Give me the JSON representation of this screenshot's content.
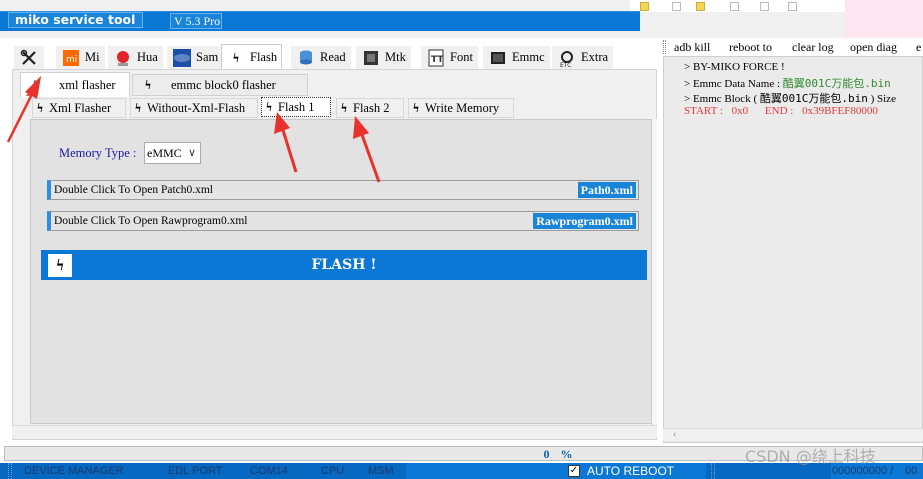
{
  "window": {
    "title": "miko service tool",
    "version": "V 5.3 Pro"
  },
  "menu": {
    "tools_icon": "tools-icon",
    "items": [
      {
        "label": "Mi",
        "icon": "xiaomi-icon"
      },
      {
        "label": "Hua",
        "icon": "huawei-icon"
      },
      {
        "label": "Sam",
        "icon": "samsung-icon"
      },
      {
        "label": "Flash",
        "icon": "bolt-icon",
        "active": true
      },
      {
        "label": "Read",
        "icon": "database-icon"
      },
      {
        "label": "Mtk",
        "icon": "chip-icon"
      },
      {
        "label": "Font",
        "icon": "font-file-icon"
      },
      {
        "label": "Emmc",
        "icon": "emmc-chip-icon"
      },
      {
        "label": "Extra",
        "icon": "extra-icon"
      }
    ]
  },
  "flash_tabs": [
    {
      "label": "xml flasher",
      "active": true
    },
    {
      "label": "emmc block0 flasher"
    }
  ],
  "xml_tabs": [
    {
      "label": "Xml Flasher"
    },
    {
      "label": "Without-Xml-Flash"
    },
    {
      "label": "Flash 1",
      "active": true
    },
    {
      "label": "Flash 2"
    },
    {
      "label": "Write Memory"
    }
  ],
  "memory": {
    "label": "Memory Type :",
    "selected": "eMMC"
  },
  "patch": {
    "hint": "Double Click To Open Patch0.xml",
    "button": "Path0.xml"
  },
  "rawprogram": {
    "hint": "Double Click To Open Rawprogram0.xml",
    "button": "Rawprogram0.xml"
  },
  "flash_button": "FLASH !",
  "right_menu": [
    "adb kill",
    "reboot to",
    "clear log",
    "open diag",
    "e"
  ],
  "log": {
    "line1": "> BY-MIKO FORCE !",
    "line2_label": "> Emmc Data Name :",
    "line2_value": "酷翼001C万能包.bin",
    "line3_label": "> Emmc Block (",
    "line3_value": "酷翼001C万能包.bin",
    "line3_suffix": ") Size",
    "line4_start_label": "START :",
    "line4_start_value": "0x0",
    "line4_end_label": "END :",
    "line4_end_value": "0x39BFEF80000"
  },
  "progress": {
    "text": "0 %",
    "value": 0
  },
  "status": {
    "device_manager": "DEVICE MANAGER",
    "edl_port": "EDL PORT",
    "com": "COM14",
    "cpu": "CPU",
    "msm": "MSM",
    "auto_reboot": "AUTO REBOOT",
    "auto_reboot_checked": "✓",
    "counter": "000000000 /",
    "counter_tail": "00"
  },
  "watermark": "CSDN @绕上科技",
  "colors": {
    "accent": "#0a78d4",
    "annotation_arrow": "#e8322b",
    "log_green": "#2f8b2f",
    "log_red": "#e23b3b",
    "memory_label": "#1a1aa8"
  }
}
